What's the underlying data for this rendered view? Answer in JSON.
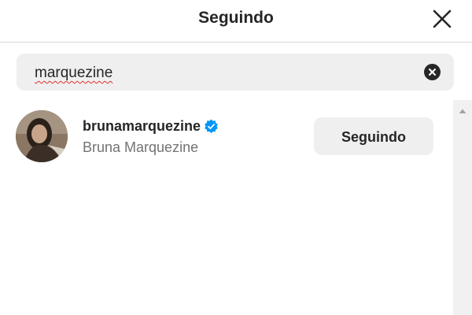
{
  "header": {
    "title": "Seguindo",
    "close_icon": "close-icon"
  },
  "search": {
    "value": "marquezine",
    "clear_icon": "clear-circle-icon"
  },
  "results": [
    {
      "username": "brunamarquezine",
      "verified": true,
      "full_name": "Bruna Marquezine",
      "button_label": "Seguindo"
    }
  ],
  "colors": {
    "verified_badge": "#0095f6",
    "button_bg": "#efefef",
    "search_bg": "#efefef",
    "secondary_text": "#737373"
  }
}
